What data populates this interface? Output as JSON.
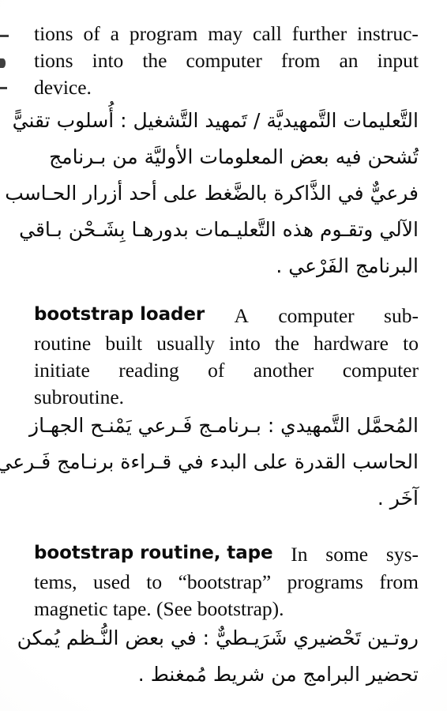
{
  "page": {
    "kind": "scanned-dictionary-page",
    "language_pair": "English–Arabic",
    "background_color": "#ffffff",
    "ink_color": "#0c0c0c"
  },
  "continued_entry": {
    "lines": [
      "tions of a program may call further instruc-",
      "tions into the computer from an input",
      "device."
    ],
    "arabic_lines": [
      "التَّعليمات التَّمهيديَّة / تَمهيد التَّشغيل : أُسلوب تقنيًّ",
      "تُشحن فيه بعض المعلومات الأوليَّة من بـرنامج",
      "فرعيٌّ في الذَّاكرة بالضَّغط على أحد أزرار الحـاسب",
      "الآلي وتقـوم هذه التَّعليـمات بدورهـا بِشَـحْن بـاقي",
      "البرنامج الفَرْعي ."
    ]
  },
  "entries": [
    {
      "headword": "bootstrap loader",
      "definition_lines": [
        "A computer sub-",
        "routine built usually into the hardware to",
        "initiate reading of another computer",
        "subroutine."
      ],
      "arabic_lines": [
        "المُحمَّل التَّمهيدي : بـرنامـج فَـرعي يَمْنـح الجهـاز",
        "الحاسب القدرة على البدء في قـراءة برنـامج فَـرعي",
        "آخَر ."
      ]
    },
    {
      "headword": "bootstrap routine, tape",
      "definition_lines": [
        "In some sys-",
        "tems, used to “bootstrap” programs from",
        "magnetic tape. (See bootstrap)."
      ],
      "arabic_lines": [
        "روتـين تَحْضيري شَرَيـطيٌّ : في بعض النُّـظم يُمكن",
        "تحضير البرامج من شريط مُمغنط ."
      ]
    }
  ],
  "en_words": {
    "p0l0": [
      "tions",
      "of",
      "a",
      "program",
      "may",
      "call",
      "further",
      "instruc-"
    ],
    "p0l1": [
      "tions",
      "into",
      "the",
      "computer",
      "from",
      "an",
      "input"
    ],
    "p0l2": "device.",
    "e1l0_rest": [
      "A",
      "computer",
      "sub-"
    ],
    "e1l1": [
      "routine",
      "built",
      "usually",
      "into",
      "the",
      "hardware",
      "to"
    ],
    "e1l2": [
      "initiate",
      "reading",
      "of",
      "another",
      "computer"
    ],
    "e1l3": "subroutine.",
    "e2l0_rest": [
      "In",
      "some",
      "sys-"
    ],
    "e2l1": [
      "tems,",
      "used",
      "to",
      "“bootstrap”",
      "programs",
      "from"
    ],
    "e2l2": "magnetic tape. (See bootstrap)."
  }
}
